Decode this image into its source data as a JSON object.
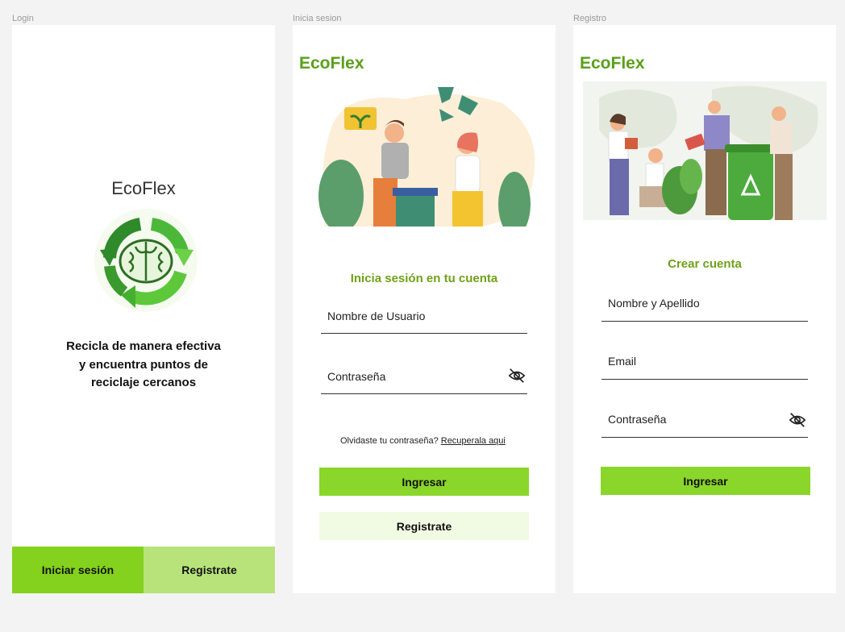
{
  "frames": {
    "login_label": "Login",
    "signin_label": "Inicia sesion",
    "register_label": "Registro"
  },
  "login": {
    "title": "EcoFlex",
    "tagline": [
      "Recicla de manera efectiva",
      "y encuentra puntos de",
      "reciclaje cercanos"
    ],
    "signin_button": "Iniciar sesión",
    "register_button": "Registrate"
  },
  "signin": {
    "brand": "EcoFlex",
    "heading": "Inicia sesión en tu cuenta",
    "username_placeholder": "Nombre de Usuario",
    "password_placeholder": "Contraseña",
    "forgot_text": "Olvidaste tu contraseña?",
    "forgot_link": "Recuperala aqui",
    "submit_button": "Ingresar",
    "register_button": "Registrate"
  },
  "register": {
    "brand": "EcoFlex",
    "heading": "Crear cuenta",
    "name_placeholder": "Nombre  y Apellido",
    "email_placeholder": "Email",
    "password_placeholder": "Contraseña",
    "submit_button": "Ingresar"
  },
  "colors": {
    "primary": "#8ad62a",
    "primary_dark": "#84d11e",
    "secondary": "#b8e37a",
    "light": "#f1fbe4",
    "brand": "#5aa01a",
    "heading": "#6ea219"
  },
  "icons": [
    "recycle-brain-logo",
    "eye-off-icon"
  ]
}
